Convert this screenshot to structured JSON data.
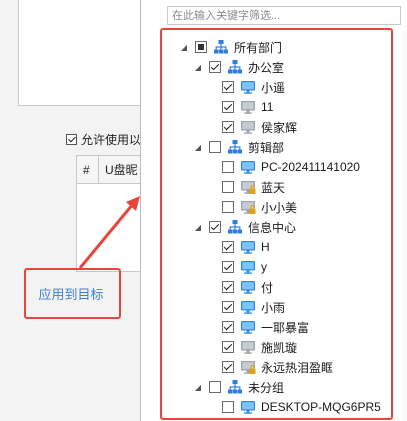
{
  "background": {
    "checkbox_label": "允许使用以",
    "table_headers": [
      "#",
      "U盘昵"
    ],
    "apply_button": "应用到目标"
  },
  "search": {
    "placeholder": "在此输入关键字筛选..."
  },
  "tree": [
    {
      "label": "所有部门",
      "level": 0,
      "type": "dept",
      "expander": "collapse",
      "check": "partial"
    },
    {
      "label": "办公室",
      "level": 1,
      "type": "dept",
      "expander": "collapse",
      "check": "checked"
    },
    {
      "label": "小遥",
      "level": 2,
      "type": "pc",
      "status": "online",
      "check": "checked"
    },
    {
      "label": "11",
      "level": 2,
      "type": "pc",
      "status": "offline",
      "check": "checked"
    },
    {
      "label": "侯家辉",
      "level": 2,
      "type": "pc",
      "status": "offline",
      "check": "checked"
    },
    {
      "label": "剪辑部",
      "level": 1,
      "type": "dept",
      "expander": "collapse",
      "check": "unchecked"
    },
    {
      "label": "PC-202411141020",
      "level": 2,
      "type": "pc",
      "status": "online",
      "check": "unchecked"
    },
    {
      "label": "蓝天",
      "level": 2,
      "type": "pc",
      "status": "locked",
      "check": "unchecked"
    },
    {
      "label": "小小美",
      "level": 2,
      "type": "pc",
      "status": "locked",
      "check": "unchecked"
    },
    {
      "label": "信息中心",
      "level": 1,
      "type": "dept",
      "expander": "collapse",
      "check": "checked"
    },
    {
      "label": "H",
      "level": 2,
      "type": "pc",
      "status": "online",
      "check": "checked"
    },
    {
      "label": "y",
      "level": 2,
      "type": "pc",
      "status": "online",
      "check": "checked"
    },
    {
      "label": "付",
      "level": 2,
      "type": "pc",
      "status": "online",
      "check": "checked"
    },
    {
      "label": "小雨",
      "level": 2,
      "type": "pc",
      "status": "online",
      "check": "checked"
    },
    {
      "label": "一耶暴富",
      "level": 2,
      "type": "pc",
      "status": "online",
      "check": "checked"
    },
    {
      "label": "施凯璇",
      "level": 2,
      "type": "pc",
      "status": "offline",
      "check": "checked"
    },
    {
      "label": "永远热泪盈眶",
      "level": 2,
      "type": "pc",
      "status": "locked",
      "check": "checked"
    },
    {
      "label": "未分组",
      "level": 1,
      "type": "dept",
      "expander": "collapse",
      "check": "unchecked"
    },
    {
      "label": "DESKTOP-MQG6PR5",
      "level": 2,
      "type": "pc",
      "status": "online",
      "check": "unchecked"
    }
  ],
  "colors": {
    "highlight": "#e8453c",
    "dept_icon": "#2f7fd8",
    "pc_online": "#2f8fe6",
    "pc_offline": "#9aa3ad",
    "lock": "#e0a21a",
    "link": "#3d7fd6"
  }
}
